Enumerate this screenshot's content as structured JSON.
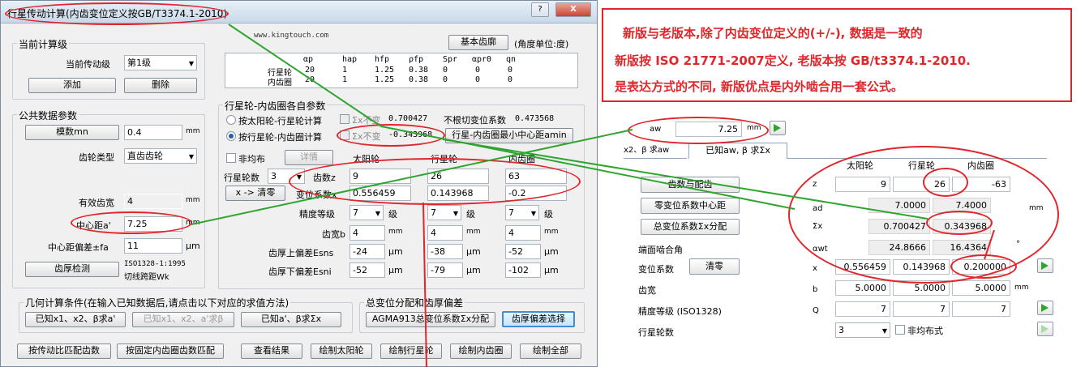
{
  "window": {
    "title": "行星传动计算(内齿变位定义按GB/T3374.1-2010)",
    "help_btn": "?",
    "close_btn": "X"
  },
  "current_stage": {
    "label": "当前计算级",
    "stage_label": "当前传动级",
    "stage_value": "第1级",
    "add_btn": "添加",
    "delete_btn": "删除"
  },
  "common": {
    "label": "公共数据参数",
    "module_btn": "模数mn",
    "module_value": "0.4",
    "module_unit": "mm",
    "gear_type_label": "齿轮类型",
    "gear_type_value": "直齿齿轮",
    "eff_width_label": "有效齿宽",
    "eff_width_value": "4",
    "eff_width_unit": "mm",
    "center_label": "中心距a'",
    "center_value": "7.25",
    "center_unit": "mm",
    "center_dev_label": "中心距偏差±fa",
    "center_dev_value": "11",
    "center_dev_unit": "μm",
    "thickness_btn": "齿厚检测",
    "thickness_line1": "ISO1328-1:1995",
    "thickness_line2": "切线跨距Wk"
  },
  "header": {
    "website": "www.kingtouch.com",
    "basic_tooth_btn": "基本齿廓",
    "angle_unit": "(角度单位:度)"
  },
  "tooth_table": {
    "columns": [
      "αp",
      "hap",
      "hfp",
      "ρfp",
      "Spr",
      "αpr0",
      "qn"
    ],
    "rows": [
      {
        "name": "行星轮",
        "values": [
          "20",
          "1",
          "1.25",
          "0.38",
          "0",
          "0",
          "0"
        ]
      },
      {
        "name": "内齿圈",
        "values": [
          "20",
          "1",
          "1.25",
          "0.38",
          "0",
          "0",
          "0"
        ]
      }
    ]
  },
  "pi": {
    "label": "行星轮-内齿圈各自参数",
    "radio1": "按太阳轮-行星轮计算",
    "radio2": "按行星轮-内齿圈计算",
    "sum_x_label": "Σx不变",
    "sum_x_1": "0.700427",
    "sum_x_2": "-0.343968",
    "no_undercut_label": "不根切变位系数",
    "no_undercut_value": "0.473568",
    "min_center_btn": "行星-内齿圈最小中心距amin",
    "uneven_label": "非均布",
    "detail_btn": "详情",
    "planets_label": "行星轮数",
    "planets_value": "3",
    "x_clear_btn": "x -> 清零",
    "col_sun": "太阳轮",
    "col_planet": "行星轮",
    "col_ring": "内齿圈",
    "teeth_label": "齿数z",
    "teeth": [
      "9",
      "26",
      "63"
    ],
    "shift_label": "变位系数x",
    "shift": [
      "0.556459",
      "0.143968",
      "-0.2"
    ],
    "grade_label": "精度等级",
    "grade": [
      "7",
      "7",
      "7"
    ],
    "grade_unit": "级",
    "width_label": "齿宽b",
    "width": [
      "4",
      "4",
      "4"
    ],
    "mm": "mm",
    "upper_label": "齿厚上偏差Esns",
    "upper": [
      "-24",
      "-38",
      "-52"
    ],
    "um": "μm",
    "lower_label": "齿厚下偏差Esni",
    "lower": [
      "-52",
      "-79",
      "-102"
    ]
  },
  "geometry": {
    "label": "几何计算条件(在输入已知数据后,请点击以下对应的求值方法)",
    "btn1": "已知x1、x2、β求a'",
    "btn2": "已知x1、x2、a'求β",
    "btn3": "已知a'、β求Σx"
  },
  "shift_dist": {
    "label": "总变位分配和齿厚偏差",
    "agma_btn": "AGMA913总变位系数Σx分配",
    "thickness_btn": "齿厚偏差选择"
  },
  "bottom_buttons": [
    "按传动比匹配齿数",
    "按固定内齿圈齿数匹配",
    "查看结果",
    "绘制太阳轮",
    "绘制行星轮",
    "绘制内齿圈",
    "绘制全部"
  ],
  "note": {
    "line1": "新版与老版本,除了内齿变位定义的(+/-), 数据是一致的",
    "line2": "新版按 ISO 21771-2007定义, 老版本按 GB/t3374.1-2010.",
    "line3": "是表达方式的不同, 新版优点是内外啮合用一套公式。"
  },
  "new_version": {
    "aw_label": "aw",
    "aw_value": "7.25",
    "aw_unit": "mm",
    "tab1": "x2、β 求aw",
    "tab2": "已知aw, β 求Σx",
    "col_sun": "太阳轮",
    "col_planet": "行星轮",
    "col_ring": "内齿圈",
    "teeth_btn": "齿数与配齿",
    "z_sym": "z",
    "z": [
      "9",
      "26",
      "-63"
    ],
    "zero_btn": "零变位系数中心距",
    "ad_sym": "ad",
    "ad": [
      "7.0000",
      "7.4000"
    ],
    "mm": "mm",
    "sum_btn": "总变位系数Σx分配",
    "sum_sym": "Σx",
    "sum": [
      "0.700427",
      "0.343968"
    ],
    "alpha_label": "端面啮合角",
    "alpha_sym": "αwt",
    "alpha": [
      "24.8666",
      "16.4364"
    ],
    "deg": "°",
    "shift_label": "变位系数",
    "clear_btn": "清零",
    "x_sym": "x",
    "x": [
      "0.556459",
      "0.143968",
      "0.200000"
    ],
    "width_label": "齿宽",
    "b_sym": "b",
    "b": [
      "5.0000",
      "5.0000",
      "5.0000"
    ],
    "grade_label": "精度等级 (ISO1328)",
    "q_sym": "Q",
    "q": [
      "7",
      "7",
      "7"
    ],
    "planets_label": "行星轮数",
    "planets_value": "3",
    "uneven_label": "非均布式"
  }
}
